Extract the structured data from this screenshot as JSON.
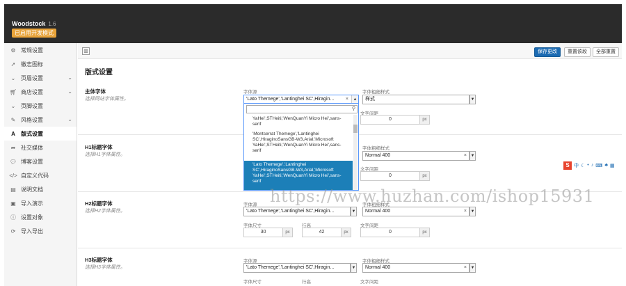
{
  "header": {
    "app_name": "Woodstock",
    "version": "1.6",
    "badge": "已启用开发模式"
  },
  "sidebar": {
    "items": [
      {
        "label": "常规设置",
        "icon": "gears-icon"
      },
      {
        "label": "徽志图标",
        "icon": "rocket-icon"
      },
      {
        "label": "页眉设置",
        "icon": "chevron-down-icon"
      },
      {
        "label": "商店设置",
        "icon": "cart-icon"
      },
      {
        "label": "页脚设置",
        "icon": "chevron-down-icon"
      },
      {
        "label": "风格设置",
        "icon": "brush-icon"
      },
      {
        "label": "版式设置",
        "icon": "font-icon"
      },
      {
        "label": "社交媒体",
        "icon": "share-icon"
      },
      {
        "label": "博客设置",
        "icon": "comments-icon"
      },
      {
        "label": "自定义代码",
        "icon": "code-icon"
      },
      {
        "label": "说明文档",
        "icon": "file-icon"
      },
      {
        "label": "导入演示",
        "icon": "import-icon"
      },
      {
        "label": "设置对象",
        "icon": "info-icon"
      },
      {
        "label": "导入导出",
        "icon": "refresh-icon"
      }
    ]
  },
  "toolbar": {
    "save": "保存更改",
    "reset_section": "重置该段",
    "reset_all": "全部重置"
  },
  "main": {
    "title": "版式设置",
    "body_font": {
      "label": "主体字体",
      "desc": "选择网站字体属性。",
      "family_label": "字体源",
      "family_value": "'Lato Themege','Lantinghei SC',Hiragin...",
      "weight_label": "字体粗细样式",
      "weight_value": "样式",
      "spacing_label": "文字间距",
      "spacing_value": "0",
      "unit": "px"
    },
    "dropdown": {
      "options": [
        "YaHei',STHeiti,'WenQuanYi Micro Hei',sans-serif",
        "'Montserrat Themege','Lantinghei SC',HiraginoSansGB-W3,Arial,'Microsoft YaHei',STHeiti,'WenQuanYi Micro Hei',sans-serif",
        "'Lato Themege','Lantinghei SC',HiraginoSansGB-W3,Arial,'Microsoft YaHei',STHeiti,'WenQuanYi Micro Hei',sans-serif"
      ]
    },
    "h1": {
      "label": "H1标题字体",
      "desc": "选择H1字体属性。",
      "weight_label": "字体粗细样式",
      "weight_value": "Normal 400",
      "spacing_label": "文字间距",
      "spacing_value": "0",
      "unit": "px"
    },
    "h2": {
      "label": "H2标题字体",
      "desc": "选择H2字体属性。",
      "family_label": "字体源",
      "family_value": "'Lato Themege','Lantinghei SC',Hiragin...",
      "weight_label": "字体粗细样式",
      "weight_value": "Normal 400",
      "size_label": "字体尺寸",
      "size_value": "30",
      "line_label": "行高",
      "line_value": "42",
      "spacing_label": "文字间距",
      "spacing_value": "0",
      "unit": "px"
    },
    "h3": {
      "label": "H3标题字体",
      "desc": "选择H3字体属性。",
      "family_label": "字体源",
      "family_value": "'Lato Themege','Lantinghei SC',Hiragin...",
      "weight_label": "字体粗细样式",
      "weight_value": "Normal 400",
      "size_label": "字体尺寸",
      "line_label": "行高",
      "spacing_label": "文字间距"
    }
  },
  "watermark": "https://www.huzhan.com/ishop15931"
}
